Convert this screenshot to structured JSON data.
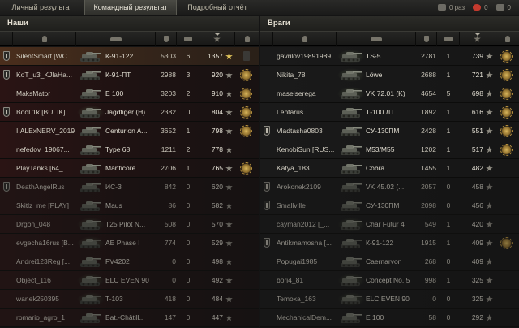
{
  "tabs": [
    {
      "label": "Личный результат",
      "active": false
    },
    {
      "label": "Командный результат",
      "active": true
    },
    {
      "label": "Подробный отчёт",
      "active": false
    }
  ],
  "top_stats": {
    "left_value": "0 раз",
    "heart_value": "0",
    "right_value": "0"
  },
  "left_team": {
    "title": "Наши",
    "rows": [
      {
        "player": "SilentSmart [WC...",
        "tank": "К-91-122",
        "damage": "5303",
        "frags": "6",
        "xp": "1357",
        "squad": true,
        "medal": false,
        "player_row": true,
        "dead": false,
        "premium": false
      },
      {
        "player": "KoT_u3_KJlaHa...",
        "tank": "К-91-ПТ",
        "damage": "2988",
        "frags": "3",
        "xp": "920",
        "squad": true,
        "medal": true,
        "player_row": false,
        "dead": false,
        "premium": false
      },
      {
        "player": "MaksMator",
        "tank": "E 100",
        "damage": "3203",
        "frags": "2",
        "xp": "910",
        "squad": false,
        "medal": true,
        "player_row": false,
        "dead": false,
        "premium": false
      },
      {
        "player": "BooL1k [BULIK]",
        "tank": "Jagdtiger (H)",
        "damage": "2382",
        "frags": "0",
        "xp": "804",
        "squad": true,
        "medal": true,
        "player_row": false,
        "dead": false,
        "premium": true
      },
      {
        "player": "IIALExNERV_2019",
        "tank": "Centurion A...",
        "damage": "3652",
        "frags": "1",
        "xp": "798",
        "squad": false,
        "medal": true,
        "player_row": false,
        "dead": false,
        "premium": false
      },
      {
        "player": "nefedov_19067...",
        "tank": "Type 68",
        "damage": "1211",
        "frags": "2",
        "xp": "778",
        "squad": false,
        "medal": false,
        "player_row": false,
        "dead": false,
        "premium": false
      },
      {
        "player": "PlayTanks [64_...",
        "tank": "Manticore",
        "damage": "2706",
        "frags": "1",
        "xp": "765",
        "squad": false,
        "medal": true,
        "player_row": false,
        "dead": false,
        "premium": false
      },
      {
        "player": "DeathAngelRus",
        "tank": "ИС-3",
        "damage": "842",
        "frags": "0",
        "xp": "620",
        "squad": true,
        "medal": false,
        "player_row": false,
        "dead": true,
        "premium": false
      },
      {
        "player": "Skitlz_me [PLAY]",
        "tank": "Maus",
        "damage": "86",
        "frags": "0",
        "xp": "582",
        "squad": false,
        "medal": false,
        "player_row": false,
        "dead": true,
        "premium": false
      },
      {
        "player": "Drgon_048",
        "tank": "T25 Pilot N...",
        "damage": "508",
        "frags": "0",
        "xp": "570",
        "squad": false,
        "medal": false,
        "player_row": false,
        "dead": true,
        "premium": true
      },
      {
        "player": "evgecha16rus [B...",
        "tank": "AE Phase I",
        "damage": "774",
        "frags": "0",
        "xp": "529",
        "squad": false,
        "medal": false,
        "player_row": false,
        "dead": true,
        "premium": true
      },
      {
        "player": "Andrei123Reg [...",
        "tank": "FV4202",
        "damage": "0",
        "frags": "0",
        "xp": "498",
        "squad": false,
        "medal": false,
        "player_row": false,
        "dead": true,
        "premium": false
      },
      {
        "player": "Object_116",
        "tank": "ELC EVEN 90",
        "damage": "0",
        "frags": "0",
        "xp": "492",
        "squad": false,
        "medal": false,
        "player_row": false,
        "dead": true,
        "premium": true
      },
      {
        "player": "wanek250395",
        "tank": "T-103",
        "damage": "418",
        "frags": "0",
        "xp": "484",
        "squad": false,
        "medal": false,
        "player_row": false,
        "dead": true,
        "premium": true
      },
      {
        "player": "romario_agro_1",
        "tank": "Bat.-Châtill...",
        "damage": "147",
        "frags": "0",
        "xp": "447",
        "squad": false,
        "medal": false,
        "player_row": false,
        "dead": true,
        "premium": false
      }
    ]
  },
  "right_team": {
    "title": "Враги",
    "rows": [
      {
        "player": "gavrilov19891989",
        "tank": "TS-5",
        "damage": "2781",
        "frags": "1",
        "xp": "739",
        "squad": false,
        "medal": true,
        "dead": false,
        "premium": true
      },
      {
        "player": "Nikita_78",
        "tank": "Löwe",
        "damage": "2688",
        "frags": "1",
        "xp": "721",
        "squad": false,
        "medal": true,
        "dead": false,
        "premium": true
      },
      {
        "player": "maselserega",
        "tank": "VK 72.01 (K)",
        "damage": "4654",
        "frags": "5",
        "xp": "698",
        "squad": false,
        "medal": true,
        "dead": false,
        "premium": true
      },
      {
        "player": "Lentarus",
        "tank": "Т-100 ЛТ",
        "damage": "1892",
        "frags": "1",
        "xp": "616",
        "squad": false,
        "medal": true,
        "dead": false,
        "premium": false
      },
      {
        "player": "Vladtasha0803",
        "tank": "СУ-130ПМ",
        "damage": "2428",
        "frags": "1",
        "xp": "551",
        "squad": true,
        "medal": true,
        "dead": false,
        "premium": false
      },
      {
        "player": "KenobiSun [RUS...",
        "tank": "M53/M55",
        "damage": "1202",
        "frags": "1",
        "xp": "517",
        "squad": false,
        "medal": true,
        "dead": false,
        "premium": false
      },
      {
        "player": "Katya_183",
        "tank": "Cobra",
        "damage": "1455",
        "frags": "1",
        "xp": "482",
        "squad": false,
        "medal": false,
        "dead": false,
        "premium": false
      },
      {
        "player": "Arokonek2109",
        "tank": "VK 45.02 (...",
        "damage": "2057",
        "frags": "0",
        "xp": "458",
        "squad": true,
        "medal": false,
        "dead": true,
        "premium": false
      },
      {
        "player": "Smallville",
        "tank": "СУ-130ПМ",
        "damage": "2098",
        "frags": "0",
        "xp": "456",
        "squad": true,
        "medal": false,
        "dead": true,
        "premium": false
      },
      {
        "player": "cayman2012 [_...",
        "tank": "Char Futur 4",
        "damage": "549",
        "frags": "1",
        "xp": "420",
        "squad": false,
        "medal": false,
        "dead": true,
        "premium": true
      },
      {
        "player": "Antikmamosha [...",
        "tank": "К-91-122",
        "damage": "1915",
        "frags": "1",
        "xp": "409",
        "squad": true,
        "medal": true,
        "dead": true,
        "premium": false
      },
      {
        "player": "Popugai1985",
        "tank": "Caernarvon",
        "damage": "268",
        "frags": "0",
        "xp": "409",
        "squad": false,
        "medal": false,
        "dead": true,
        "premium": false
      },
      {
        "player": "bori4_81",
        "tank": "Concept No. 5",
        "damage": "998",
        "frags": "1",
        "xp": "325",
        "squad": false,
        "medal": false,
        "dead": true,
        "premium": true
      },
      {
        "player": "Temoxa_163",
        "tank": "ELC EVEN 90",
        "damage": "0",
        "frags": "0",
        "xp": "325",
        "squad": false,
        "medal": false,
        "dead": true,
        "premium": true
      },
      {
        "player": "MechanicalDem...",
        "tank": "E 100",
        "damage": "58",
        "frags": "0",
        "xp": "292",
        "squad": false,
        "medal": false,
        "dead": true,
        "premium": false
      }
    ]
  }
}
